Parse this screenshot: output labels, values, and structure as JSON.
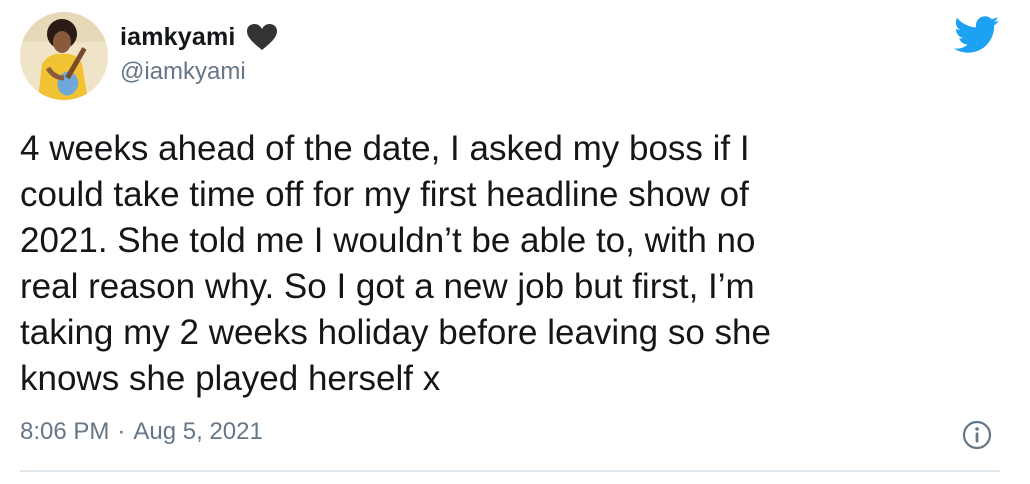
{
  "user": {
    "display_name": "iamkyami",
    "handle": "@iamkyami",
    "verified_badge_icon": "heart-icon",
    "avatar_icon": "avatar-photo"
  },
  "brand": {
    "icon": "twitter-bird-icon",
    "color": "#1da1f2"
  },
  "tweet": {
    "lines": [
      "4 weeks ahead of the date, I asked my boss if I",
      "could take time off for my first headline show of",
      "2021. She told me I wouldn’t be able to, with no",
      "real reason why. So I got a new job but first, I’m",
      "taking my 2 weeks holiday before leaving so she",
      "knows she played herself x"
    ],
    "time": "8:06 PM",
    "separator": "·",
    "date": "Aug 5, 2021",
    "info_icon": "info-icon"
  },
  "colors": {
    "text": "#14171a",
    "secondary": "#657786",
    "divider": "#e1e8ed",
    "heart": "#333333"
  }
}
